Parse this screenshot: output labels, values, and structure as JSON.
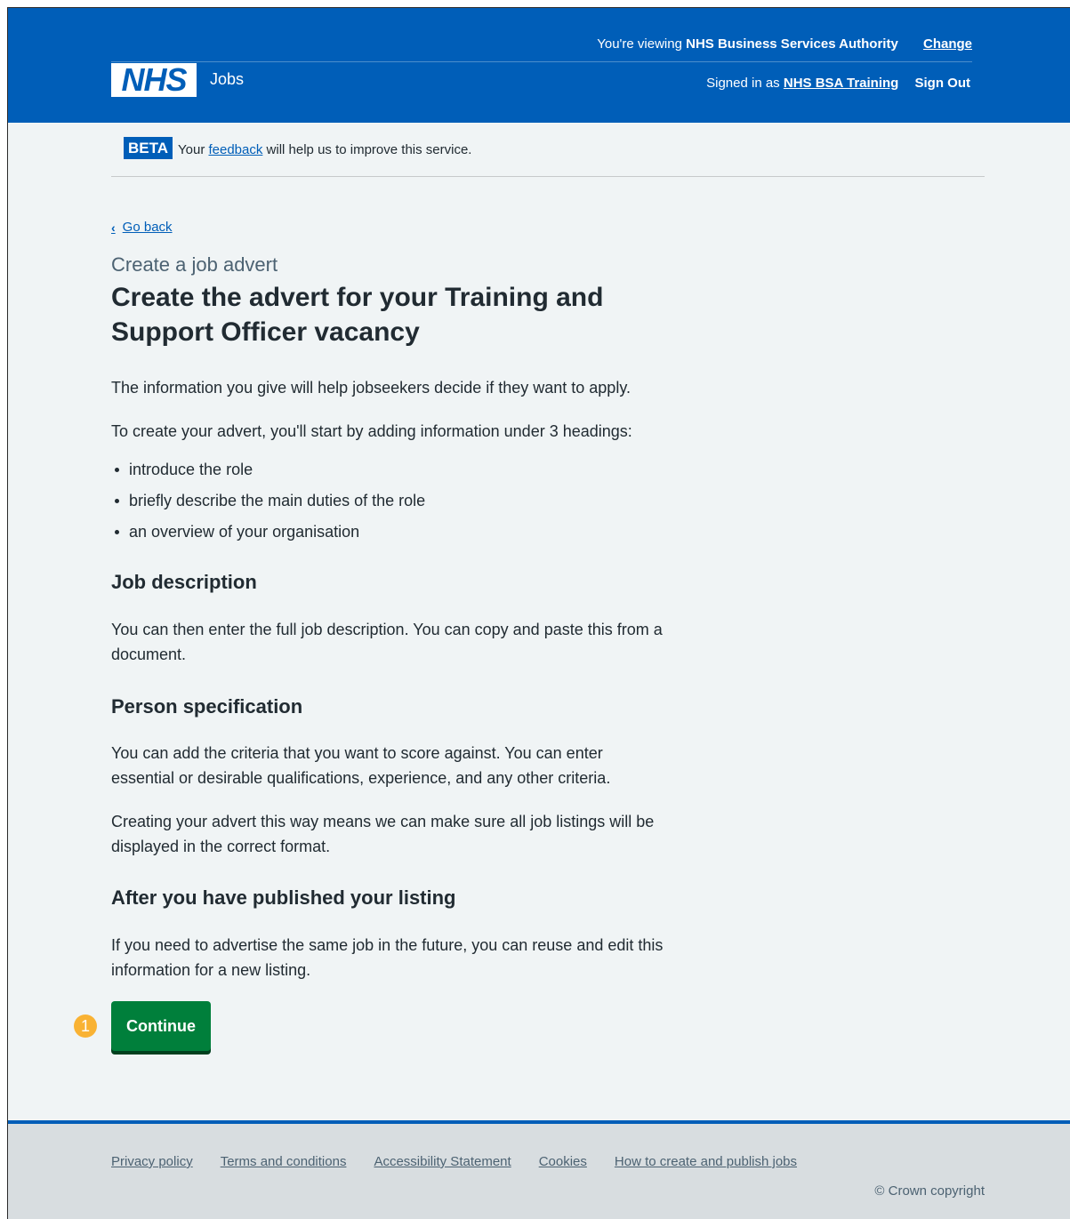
{
  "header": {
    "logo_text": "NHS",
    "service_name": "Jobs",
    "viewing_prefix": "You're viewing",
    "viewing_org": "NHS Business Services Authority",
    "change_label": "Change",
    "signed_in_prefix": "Signed in as",
    "signed_in_user": "NHS BSA Training",
    "sign_out_label": "Sign Out"
  },
  "beta": {
    "tag": "BETA",
    "text_before": "Your",
    "link": "feedback",
    "text_after": "will help us to improve this service."
  },
  "back_label": "Go back",
  "caption": "Create a job advert",
  "title": "Create the advert for your Training and Support Officer vacancy",
  "intro": "The information you give will help jobseekers decide if they want to apply.",
  "headings_intro": "To create your advert, you'll start by adding information under 3 headings:",
  "bullets": [
    "introduce the role",
    "briefly describe the main duties of the role",
    "an overview of your organisation"
  ],
  "job_description": {
    "heading": "Job description",
    "text": "You can then enter the full job description. You can copy and paste this from a document."
  },
  "person_spec": {
    "heading": "Person specification",
    "text": "You can add the criteria that you want to score against. You can enter essential or desirable qualifications, experience, and any other criteria.",
    "text2": "Creating your advert this way means we can make sure all job listings will be displayed in the correct format."
  },
  "after_publish": {
    "heading": "After you have published your listing",
    "text": "If you need to advertise the same job in the future, you can reuse and edit this information for a new listing."
  },
  "annotation_badge": "1",
  "continue_label": "Continue",
  "footer": {
    "links": [
      "Privacy policy",
      "Terms and conditions",
      "Accessibility Statement",
      "Cookies",
      "How to create and publish jobs"
    ],
    "copyright": "© Crown copyright"
  },
  "colors": {
    "nhs_blue": "#005eb8",
    "button_green": "#007f3b",
    "badge_orange": "#f9b233",
    "background": "#f0f4f5"
  }
}
